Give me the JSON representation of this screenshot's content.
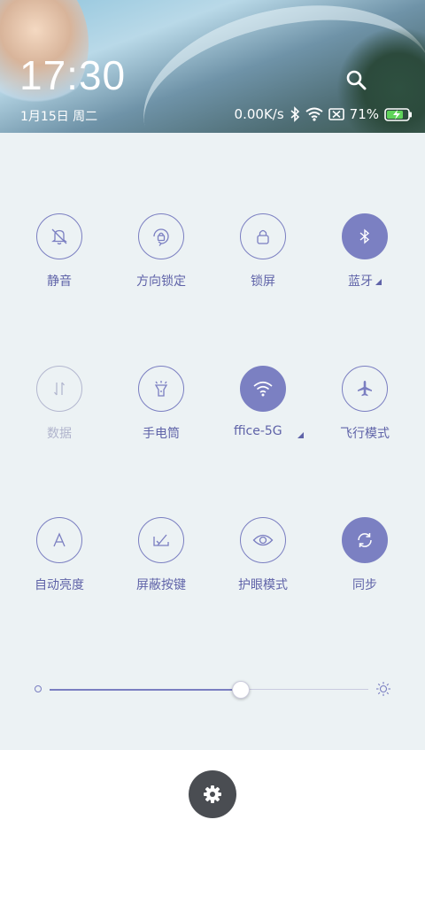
{
  "status_bar": {
    "time": "17:30",
    "date": "1月15日 周二",
    "net_speed": "0.00K/s",
    "battery": "71%"
  },
  "toggles": [
    {
      "label": "静音",
      "icon": "bell-off-icon",
      "state": "off"
    },
    {
      "label": "方向锁定",
      "icon": "rotation-lock-icon",
      "state": "off"
    },
    {
      "label": "锁屏",
      "icon": "lock-icon",
      "state": "off"
    },
    {
      "label": "蓝牙",
      "icon": "bluetooth-icon",
      "state": "on"
    },
    {
      "label": "数据",
      "icon": "data-arrows-icon",
      "state": "disabled"
    },
    {
      "label": "手电筒",
      "icon": "flashlight-icon",
      "state": "off"
    },
    {
      "label": "ffice-5G",
      "icon": "wifi-icon",
      "state": "on"
    },
    {
      "label": "飞行模式",
      "icon": "airplane-icon",
      "state": "off"
    },
    {
      "label": "自动亮度",
      "icon": "auto-brightness-icon",
      "state": "off"
    },
    {
      "label": "屏蔽按键",
      "icon": "block-keys-icon",
      "state": "off"
    },
    {
      "label": "护眼模式",
      "icon": "eye-icon",
      "state": "off"
    },
    {
      "label": "同步",
      "icon": "sync-icon",
      "state": "on"
    }
  ],
  "brightness": {
    "level": 0.6
  },
  "colors": {
    "accent": "#7b80c2",
    "panel_bg": "#ecf2f4",
    "settings_bg": "#4a4d52"
  }
}
